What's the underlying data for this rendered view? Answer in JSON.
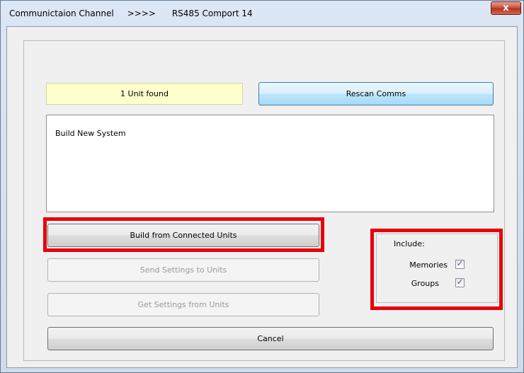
{
  "window": {
    "title": "Communictaion Channel     >>>>      RS485 Comport 14",
    "close_glyph": "x"
  },
  "status": {
    "text": "1 Unit found"
  },
  "buttons": {
    "rescan": "Rescan Comms",
    "build_connected": "Build from Connected Units",
    "send_settings": "Send Settings to Units",
    "get_settings": "Get Settings from Units",
    "cancel": "Cancel"
  },
  "build_box": {
    "text": "Build New System"
  },
  "include": {
    "label": "Include:",
    "options": [
      {
        "label": "Memories",
        "checked": true
      },
      {
        "label": "Groups",
        "checked": true
      }
    ]
  },
  "check_glyph": "✓",
  "colors": {
    "highlight": "#e8000b",
    "status_bg": "#ffffcc",
    "accent_button": "#bee6fd"
  }
}
